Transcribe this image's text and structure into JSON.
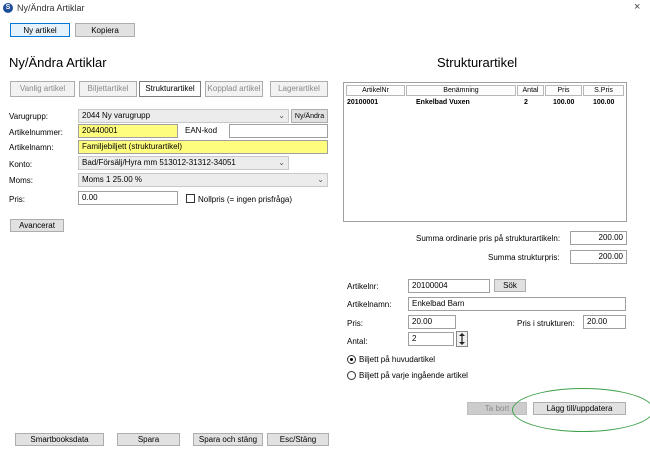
{
  "window": {
    "title": "Ny/Ändra Artiklar",
    "close": "×"
  },
  "toolbar": {
    "new_label": "Ny artikel",
    "copy_label": "Kopiera"
  },
  "left_heading": "Ny/Ändra Artiklar",
  "right_heading": "Strukturartikel",
  "tabs": [
    {
      "label": "Vanlig artikel"
    },
    {
      "label": "Biljettartikel"
    },
    {
      "label": "Strukturartikel"
    },
    {
      "label": "Kopplad artikel"
    },
    {
      "label": "Lagerartikel"
    }
  ],
  "form": {
    "varugrupp_label": "Varugrupp:",
    "varugrupp_value": "2044 Ny varugrupp",
    "ny_andra_label": "Ny/Ändra",
    "artikelnummer_label": "Artikelnummer:",
    "artikelnummer_value": "20440001",
    "ean_label": "EAN-kod",
    "ean_value": "",
    "artikelnamn_label": "Artikelnamn:",
    "artikelnamn_value": "Familjebiljett (strukturartikel)",
    "konto_label": "Konto:",
    "konto_value": "Bad/Försälj/Hyra mm 513012-31312-34051",
    "moms_label": "Moms:",
    "moms_value": "Moms 1 25.00 %",
    "pris_label": "Pris:",
    "pris_value": "0.00",
    "nollpris_label": "Nollpris (= ingen prisfråga)",
    "avancerat_label": "Avancerat"
  },
  "grid": {
    "headers": [
      "ArtikelNr",
      "Benämning",
      "Antal",
      "Pris",
      "S.Pris"
    ],
    "rows": [
      {
        "artikelnr": "20100001",
        "benamning": "Enkelbad Vuxen",
        "antal": "2",
        "pris": "100.00",
        "spris": "100.00"
      }
    ]
  },
  "summary": {
    "ordinarie_label": "Summa ordinarie pris på strukturartikeln:",
    "ordinarie_value": "200.00",
    "struktur_label": "Summa strukturpris:",
    "struktur_value": "200.00"
  },
  "detail": {
    "artikelnr_label": "Artikelnr:",
    "artikelnr_value": "20100004",
    "sok_label": "Sök",
    "artikelnamn_label": "Artikelnamn:",
    "artikelnamn_value": "Enkelbad Barn",
    "pris_label": "Pris:",
    "pris_value": "20.00",
    "pris_struktur_label": "Pris i strukturen:",
    "pris_struktur_value": "20.00",
    "antal_label": "Antal:",
    "antal_value": "2",
    "radio1_label": "Biljett på huvudartikel",
    "radio2_label": "Biljett på varje ingående artikel",
    "ta_bort_label": "Ta bort",
    "lagg_till_label": "Lägg till/uppdatera"
  },
  "footer": {
    "smartbooks_label": "Smartbooksdata",
    "spara_label": "Spara",
    "spara_stang_label": "Spara och stäng",
    "esc_label": "Esc/Stäng"
  },
  "colors": {
    "yellow_field": "#fefd7e",
    "highlight_ring": "#3fa04a",
    "title_icon": "#1f4e9a"
  }
}
